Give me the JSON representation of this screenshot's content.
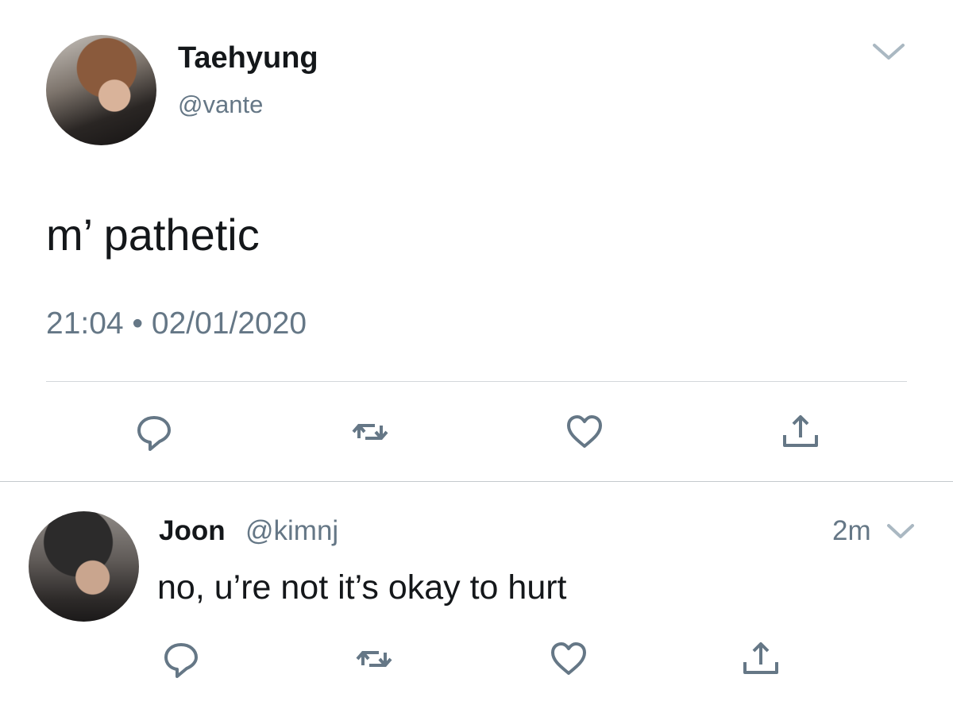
{
  "main_tweet": {
    "author": {
      "name": "Taehyung",
      "handle": "@vante"
    },
    "text": "m’ pathetic",
    "timestamp": "21:04 • 02/01/2020",
    "actions": [
      "reply-icon",
      "retweet-icon",
      "like-icon",
      "share-icon"
    ]
  },
  "reply_tweet": {
    "author": {
      "name": "Joon",
      "handle": "@kimnj"
    },
    "time": "2m",
    "text": "no, u’re not it’s okay to hurt",
    "actions": [
      "reply-icon",
      "retweet-icon",
      "like-icon",
      "share-icon"
    ]
  },
  "colors": {
    "text": "#14171a",
    "secondary": "#657786",
    "icon": "#657786",
    "divider": "#d3d7db",
    "background": "#ffffff"
  }
}
